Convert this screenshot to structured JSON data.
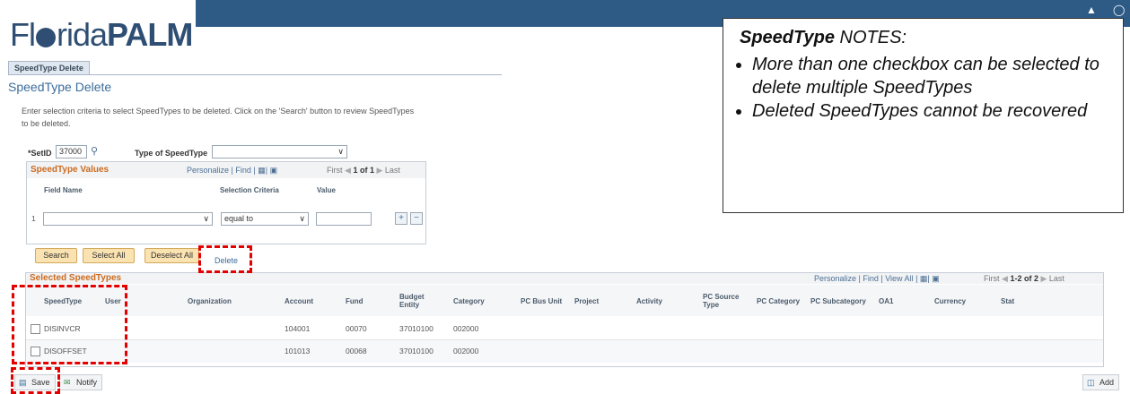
{
  "header": {
    "logo_left": "Fl",
    "logo_mid": "rida",
    "logo_bold": "PALM"
  },
  "tab": {
    "label": "SpeedType Delete"
  },
  "page_title": "SpeedType Delete",
  "instructions": "Enter selection criteria to select SpeedTypes to be deleted. Click on the 'Search' button to review SpeedTypes to be deleted.",
  "criteria": {
    "setid_label": "*SetID",
    "setid_value": "37000",
    "type_label": "Type of SpeedType",
    "type_value": ""
  },
  "values_grid": {
    "title": "SpeedType Values",
    "nav": "Personalize | Find |",
    "pager_first": "First",
    "pager_range": "1 of 1",
    "pager_last": "Last",
    "columns": [
      "Field Name",
      "Selection Criteria",
      "Value"
    ],
    "row": {
      "num": "1",
      "field_name": "",
      "criteria": "equal to",
      "value": ""
    }
  },
  "buttons": {
    "search": "Search",
    "select_all": "Select All",
    "deselect_all": "Deselect All",
    "delete": "Delete"
  },
  "selected_grid": {
    "title": "Selected SpeedTypes",
    "nav": "Personalize | Find | View All |",
    "pager_first": "First",
    "pager_range": "1-2 of 2",
    "pager_last": "Last",
    "columns": [
      "SpeedType",
      "User",
      "Organization",
      "Account",
      "Fund",
      "Budget Entity",
      "Category",
      "PC Bus Unit",
      "Project",
      "Activity",
      "PC Source Type",
      "PC Category",
      "PC Subcategory",
      "OA1",
      "Currency",
      "Stat"
    ],
    "rows": [
      {
        "speedtype": "DISINVCR",
        "account": "104001",
        "fund": "00070",
        "budget_entity": "37010100",
        "category": "002000"
      },
      {
        "speedtype": "DISOFFSET",
        "account": "101013",
        "fund": "00068",
        "budget_entity": "37010100",
        "category": "002000"
      }
    ]
  },
  "footer": {
    "save": "Save",
    "notify": "Notify",
    "add": "Add"
  },
  "notes": {
    "title_bold": "SpeedType",
    "title_rest": " NOTES:",
    "bullets": [
      "More than one checkbox can be selected to delete multiple SpeedTypes",
      "Deleted SpeedTypes cannot be recovered"
    ]
  },
  "colors": {
    "accent_orange": "#cc6b1f",
    "header_blue": "#2e5b86",
    "annotation_red": "#e30000"
  }
}
